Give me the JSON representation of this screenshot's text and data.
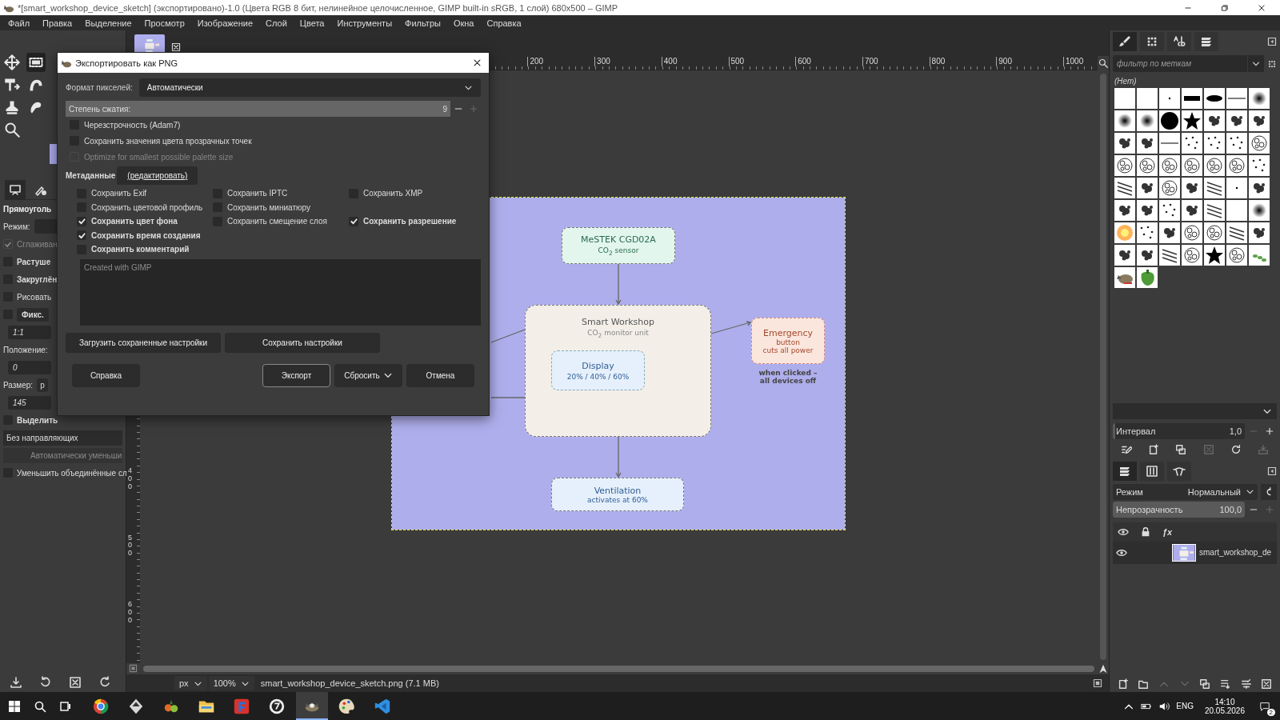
{
  "window": {
    "title": "*[smart_workshop_device_sketch] (экспортировано)-1.0 (Цвета RGB 8 бит, нелинейное целочисленное, GIMP built-in sRGB, 1 слой) 680x500 – GIMP"
  },
  "menu": [
    "Файл",
    "Правка",
    "Выделение",
    "Просмотр",
    "Изображение",
    "Слой",
    "Цвета",
    "Инструменты",
    "Фильтры",
    "Окна",
    "Справка"
  ],
  "toolbox": {
    "tools": [
      {
        "kind": "move",
        "selected": false
      },
      {
        "kind": "rect-select",
        "selected": true
      },
      {
        "kind": "align",
        "selected": false
      },
      {
        "kind": "warp",
        "selected": false
      },
      {
        "kind": "clone",
        "selected": false
      },
      {
        "kind": "smudge",
        "selected": false
      },
      {
        "kind": "zoom",
        "selected": false
      }
    ],
    "tabs": [
      {
        "kind": "tool-options",
        "selected": true
      },
      {
        "kind": "device-status",
        "selected": false
      }
    ],
    "options": [
      {
        "kind": "header",
        "label": "Прямоуголь"
      },
      {
        "kind": "mode",
        "label": "Режим:"
      },
      {
        "kind": "check",
        "label": "Сглаживан",
        "checked": true,
        "disabled": true,
        "bold": false
      },
      {
        "kind": "check",
        "label": "Растуше",
        "checked": false,
        "disabled": false,
        "bold": true
      },
      {
        "kind": "check",
        "label": "Закруглён",
        "checked": false,
        "disabled": false,
        "bold": true
      },
      {
        "kind": "check",
        "label": "Рисовать",
        "checked": false,
        "disabled": false,
        "bold": false
      },
      {
        "kind": "check-dropdown",
        "label": "Фикс.",
        "checked": false
      },
      {
        "kind": "field",
        "value": "1:1"
      },
      {
        "kind": "label",
        "label": "Положение:"
      },
      {
        "kind": "field",
        "value": "0"
      },
      {
        "kind": "label-dropdown",
        "label": "Размер:",
        "value": "p"
      },
      {
        "kind": "field",
        "value": "145"
      },
      {
        "kind": "check",
        "label": "Выделить",
        "checked": false,
        "disabled": false,
        "bold": true
      },
      {
        "kind": "dropdown",
        "value": "Без направляющих"
      },
      {
        "kind": "button",
        "label": "Автоматически уменьши",
        "disabled": true
      },
      {
        "kind": "check",
        "label": "Уменьшить объединённые сл",
        "checked": false,
        "disabled": false,
        "bold": false
      }
    ]
  },
  "rulers": {
    "horizontal": [
      "200",
      "300",
      "400",
      "500",
      "600",
      "700",
      "800",
      "900",
      "1000"
    ],
    "vertical": [
      "400",
      "500",
      "600"
    ]
  },
  "diagram": {
    "nodes": [
      {
        "kind": "sensor",
        "title": "MeSTEK CGD02A",
        "subtitle": "CO$_{2}$ sensor"
      },
      {
        "kind": "unit",
        "title": "Smart Workshop",
        "subtitle": "CO$_{2}$ monitor unit"
      },
      {
        "kind": "display",
        "title": "Display",
        "subtitle": "20% / 40% / 60%"
      },
      {
        "kind": "alert",
        "title": "Emergency",
        "subtitle": "button",
        "detail": "cuts all power"
      },
      {
        "kind": "output",
        "title": "Ventilation",
        "subtitle": "activates at 60%"
      }
    ],
    "note": [
      "when clicked –",
      "all devices off"
    ]
  },
  "status_bar": {
    "unit": "px",
    "zoom": "100%",
    "file": "smart_workshop_device_sketch.png (7.1 MB)"
  },
  "brushes": {
    "tabs": [
      {
        "kind": "brush",
        "selected": true
      },
      {
        "kind": "pattern",
        "selected": false
      },
      {
        "kind": "font",
        "selected": false
      },
      {
        "kind": "document",
        "selected": false
      }
    ],
    "filter_placeholder": "фильтр по меткам",
    "tag": "(Нет)",
    "items": [
      {
        "kind": "blank"
      },
      {
        "kind": "blank"
      },
      {
        "kind": "dot"
      },
      {
        "kind": "bar"
      },
      {
        "kind": "ellipse"
      },
      {
        "kind": "line"
      },
      {
        "kind": "soft"
      },
      {
        "kind": "soft"
      },
      {
        "kind": "soft"
      },
      {
        "kind": "hard"
      },
      {
        "kind": "star"
      },
      {
        "kind": "splatter"
      },
      {
        "kind": "splatter"
      },
      {
        "kind": "splatter"
      },
      {
        "kind": "splatter"
      },
      {
        "kind": "splatter"
      },
      {
        "kind": "line"
      },
      {
        "kind": "dots"
      },
      {
        "kind": "dots"
      },
      {
        "kind": "dots"
      },
      {
        "kind": "texture"
      },
      {
        "kind": "texture"
      },
      {
        "kind": "texture"
      },
      {
        "kind": "texture"
      },
      {
        "kind": "texture"
      },
      {
        "kind": "texture"
      },
      {
        "kind": "texture"
      },
      {
        "kind": "dots"
      },
      {
        "kind": "lines"
      },
      {
        "kind": "splatter"
      },
      {
        "kind": "texture"
      },
      {
        "kind": "splatter"
      },
      {
        "kind": "lines"
      },
      {
        "kind": "dot"
      },
      {
        "kind": "splatter"
      },
      {
        "kind": "splatter"
      },
      {
        "kind": "splatter"
      },
      {
        "kind": "dots"
      },
      {
        "kind": "splatter"
      },
      {
        "kind": "lines"
      },
      {
        "kind": "blank"
      },
      {
        "kind": "soft"
      },
      {
        "kind": "sun"
      },
      {
        "kind": "dots"
      },
      {
        "kind": "splatter"
      },
      {
        "kind": "texture"
      },
      {
        "kind": "texture"
      },
      {
        "kind": "lines"
      },
      {
        "kind": "splatter"
      },
      {
        "kind": "splatter"
      },
      {
        "kind": "splatter"
      },
      {
        "kind": "lines"
      },
      {
        "kind": "texture"
      },
      {
        "kind": "star"
      },
      {
        "kind": "texture"
      },
      {
        "kind": "leaf"
      },
      {
        "kind": "wilber"
      },
      {
        "kind": "pepper"
      }
    ],
    "spacing": {
      "label": "Интервал",
      "value": "1,0",
      "level": 0.02
    },
    "actions": [
      {
        "kind": "edit",
        "disabled": false
      },
      {
        "kind": "new",
        "disabled": false
      },
      {
        "kind": "duplicate",
        "disabled": false
      },
      {
        "kind": "delete",
        "disabled": true
      },
      {
        "kind": "refresh",
        "disabled": false
      },
      {
        "kind": "open",
        "disabled": true
      }
    ]
  },
  "layers": {
    "tabs": [
      {
        "kind": "layers",
        "selected": true
      },
      {
        "kind": "channels",
        "selected": false
      },
      {
        "kind": "paths",
        "selected": false
      }
    ],
    "mode": {
      "label": "Режим",
      "value": "Нормальный"
    },
    "opacity": {
      "label": "Непрозрачность",
      "value": "100,0",
      "level": 1
    },
    "fx_label": "ƒx",
    "rows": [
      {
        "name": "smart_workshop_de",
        "visible": true
      }
    ],
    "actions": [
      {
        "kind": "new",
        "disabled": false
      },
      {
        "kind": "folder",
        "disabled": false
      },
      {
        "kind": "up",
        "disabled": true
      },
      {
        "kind": "down",
        "disabled": true
      },
      {
        "kind": "duplicate",
        "disabled": false
      },
      {
        "kind": "merge",
        "disabled": false
      },
      {
        "kind": "anchor",
        "disabled": false
      },
      {
        "kind": "delete",
        "disabled": false
      }
    ]
  },
  "export_dialog": {
    "title": "Экспортировать как PNG",
    "pixel_format": {
      "label": "Формат пикселей:",
      "value": "Автоматически"
    },
    "compression": {
      "label": "Степень сжатия:",
      "value": "9",
      "level": 1
    },
    "options": [
      {
        "label": "Черезстрочность (Adam7)",
        "checked": false,
        "disabled": false
      },
      {
        "label": "Сохранить значения цвета прозрачных точек",
        "checked": false,
        "disabled": false
      },
      {
        "label": "Optimize for smallest possible palette size",
        "checked": false,
        "disabled": true
      }
    ],
    "metadata": {
      "label": "Метаданные",
      "edit_link": "(редактировать)",
      "rows": [
        [
          {
            "label": "Сохранить Exif",
            "checked": false,
            "bold": false
          },
          {
            "label": "Сохранить IPTC",
            "checked": false,
            "bold": false
          },
          {
            "label": "Сохранить XMP",
            "checked": false,
            "bold": false
          }
        ],
        [
          {
            "label": "Сохранить цветовой профиль",
            "checked": false,
            "bold": false
          },
          {
            "label": "Сохранить миниатюру",
            "checked": false,
            "bold": false
          }
        ],
        [
          {
            "label": "Сохранить цвет фона",
            "checked": true,
            "bold": true
          },
          {
            "label": "Сохранить смещение слоя",
            "checked": false,
            "bold": false
          },
          {
            "label": "Сохранить разрешение",
            "checked": true,
            "bold": true
          }
        ],
        [
          {
            "label": "Сохранить время создания",
            "checked": true,
            "bold": true
          }
        ],
        [
          {
            "label": "Сохранить комментарий",
            "checked": false,
            "bold": true
          }
        ]
      ]
    },
    "comment": "Created with GIMP",
    "load_settings": "Загрузить сохраненные настройки",
    "save_settings": "Сохранить настройки",
    "help": "Справка",
    "export": "Экспорт",
    "reset": "Сбросить",
    "cancel": "Отмена"
  },
  "taskbar": {
    "apps": [
      {
        "kind": "ring",
        "selected": false
      },
      {
        "kind": "pen",
        "selected": false
      },
      {
        "kind": "fruit",
        "selected": false
      },
      {
        "kind": "folder",
        "selected": false
      },
      {
        "kind": "tile",
        "selected": false
      },
      {
        "kind": "dark-circle",
        "selected": false
      },
      {
        "kind": "creature",
        "selected": true
      },
      {
        "kind": "palette",
        "selected": false
      },
      {
        "kind": "ribbon",
        "selected": false
      }
    ],
    "language": "ENG",
    "time": "14:10",
    "date": "20.05.2026",
    "notifications": "2"
  }
}
